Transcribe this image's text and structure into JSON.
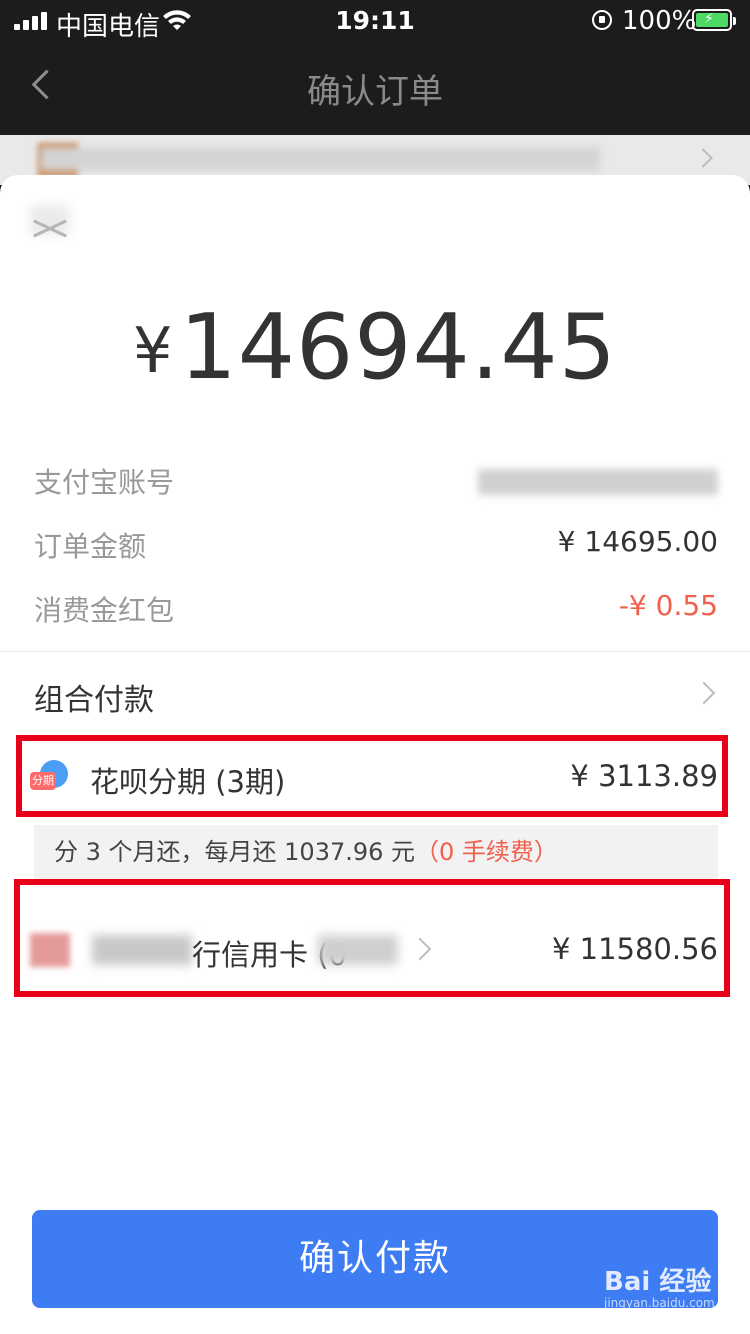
{
  "status_bar": {
    "carrier": "中国电信",
    "time": "19:11",
    "battery": "100%"
  },
  "nav": {
    "title": "确认订单"
  },
  "payment": {
    "amount": "14694.45",
    "currency_symbol": "¥",
    "rows": [
      {
        "label": "支付宝账号",
        "value": ""
      },
      {
        "label": "订单金额",
        "value": "¥ 14695.00"
      },
      {
        "label": "消费金红包",
        "value": "-¥ 0.55"
      }
    ],
    "combo_label": "组合付款",
    "huabei": {
      "icon_text": "分期",
      "label": "花呗分期 (3期)",
      "amount": "¥ 3113.89",
      "note": "分 3 个月还，每月还 1037.96 元",
      "fee_note": "（0 手续费）"
    },
    "card": {
      "label_visible": "行信用卡 (0",
      "amount": "¥ 11580.56"
    },
    "confirm_label": "确认付款"
  },
  "watermark": {
    "brand": "Bai  经验",
    "url": "jingyan.baidu.com"
  },
  "colors": {
    "accent": "#3d7cf3",
    "highlight_box": "#e8001a",
    "discount": "#f0604d"
  }
}
